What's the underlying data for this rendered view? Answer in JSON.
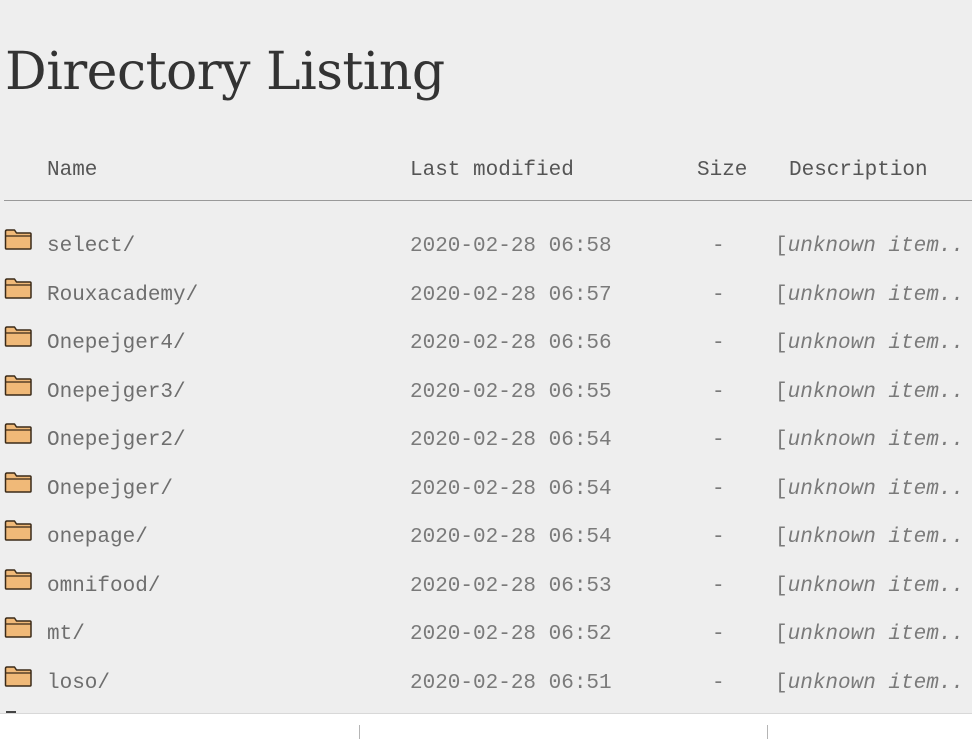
{
  "page": {
    "title": "Directory Listing"
  },
  "columns": {
    "name": "Name",
    "last_modified": "Last modified",
    "size": "Size",
    "description": "Description"
  },
  "icons": {
    "folder": "folder-icon",
    "folder_fill": "#f0b978",
    "folder_stroke": "#3a2a18"
  },
  "entries": [
    {
      "name": "select/",
      "modified": "2020-02-28 06:58",
      "size": "-",
      "bracket": "[",
      "description": "unknown item.."
    },
    {
      "name": "Rouxacademy/",
      "modified": "2020-02-28 06:57",
      "size": "-",
      "bracket": "[",
      "description": "unknown item.."
    },
    {
      "name": "Onepejger4/",
      "modified": "2020-02-28 06:56",
      "size": "-",
      "bracket": "[",
      "description": "unknown item.."
    },
    {
      "name": "Onepejger3/",
      "modified": "2020-02-28 06:55",
      "size": "-",
      "bracket": "[",
      "description": "unknown item.."
    },
    {
      "name": "Onepejger2/",
      "modified": "2020-02-28 06:54",
      "size": "-",
      "bracket": "[",
      "description": "unknown item.."
    },
    {
      "name": "Onepejger/",
      "modified": "2020-02-28 06:54",
      "size": "-",
      "bracket": "[",
      "description": "unknown item.."
    },
    {
      "name": "onepage/",
      "modified": "2020-02-28 06:54",
      "size": "-",
      "bracket": "[",
      "description": "unknown item.."
    },
    {
      "name": "omnifood/",
      "modified": "2020-02-28 06:53",
      "size": "-",
      "bracket": "[",
      "description": "unknown item.."
    },
    {
      "name": "mt/",
      "modified": "2020-02-28 06:52",
      "size": "-",
      "bracket": "[",
      "description": "unknown item.."
    },
    {
      "name": "loso/",
      "modified": "2020-02-28 06:51",
      "size": "-",
      "bracket": "[",
      "description": "unknown item.."
    }
  ]
}
